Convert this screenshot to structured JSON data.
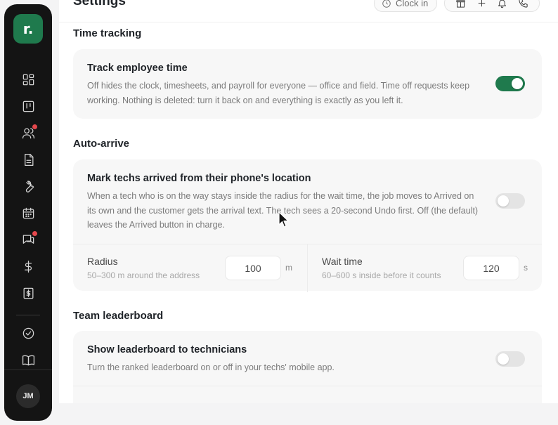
{
  "sidebar": {
    "logo_text": "r.",
    "items": [
      {
        "icon": "dashboard-icon"
      },
      {
        "icon": "board-icon"
      },
      {
        "icon": "users-icon",
        "badge": true
      },
      {
        "icon": "document-icon"
      },
      {
        "icon": "wrench-icon"
      },
      {
        "icon": "calendar-icon"
      },
      {
        "icon": "chat-icon",
        "badge": true
      },
      {
        "icon": "dollar-icon"
      },
      {
        "icon": "invoice-icon"
      }
    ],
    "secondary_items": [
      {
        "icon": "check-circle-icon"
      },
      {
        "icon": "book-icon"
      }
    ],
    "user_initials": "JM"
  },
  "header": {
    "title": "Settings",
    "clock_in_label": "Clock in",
    "actions": [
      "gift-icon",
      "plus-icon",
      "bell-icon",
      "phone-icon"
    ]
  },
  "sections": {
    "time_tracking": {
      "title": "Time tracking",
      "setting_title": "Track employee time",
      "description": "Off hides the clock, timesheets, and payroll for everyone — office and field. Time off requests keep working. Nothing is deleted: turn it back on and everything is exactly as you left it.",
      "enabled": true
    },
    "auto_arrive": {
      "title": "Auto-arrive",
      "setting_title": "Mark techs arrived from their phone's location",
      "description": "When a tech who is on the way stays inside the radius for the wait time, the job moves to Arrived on its own and the customer gets the arrival text. The tech sees a 20-second Undo first. Off (the default) leaves the Arrived button in charge.",
      "enabled": false,
      "radius": {
        "label": "Radius",
        "hint": "50–300 m around the address",
        "value": "100",
        "unit": "m"
      },
      "wait_time": {
        "label": "Wait time",
        "hint": "60–600 s inside before it counts",
        "value": "120",
        "unit": "s"
      }
    },
    "team_leaderboard": {
      "title": "Team leaderboard",
      "setting_title": "Show leaderboard to technicians",
      "description": "Turn the ranked leaderboard on or off in your techs' mobile app.",
      "enabled": false
    }
  },
  "colors": {
    "brand": "#1f7a4d",
    "badge": "#e5484d",
    "sidebar_bg": "#141414"
  }
}
